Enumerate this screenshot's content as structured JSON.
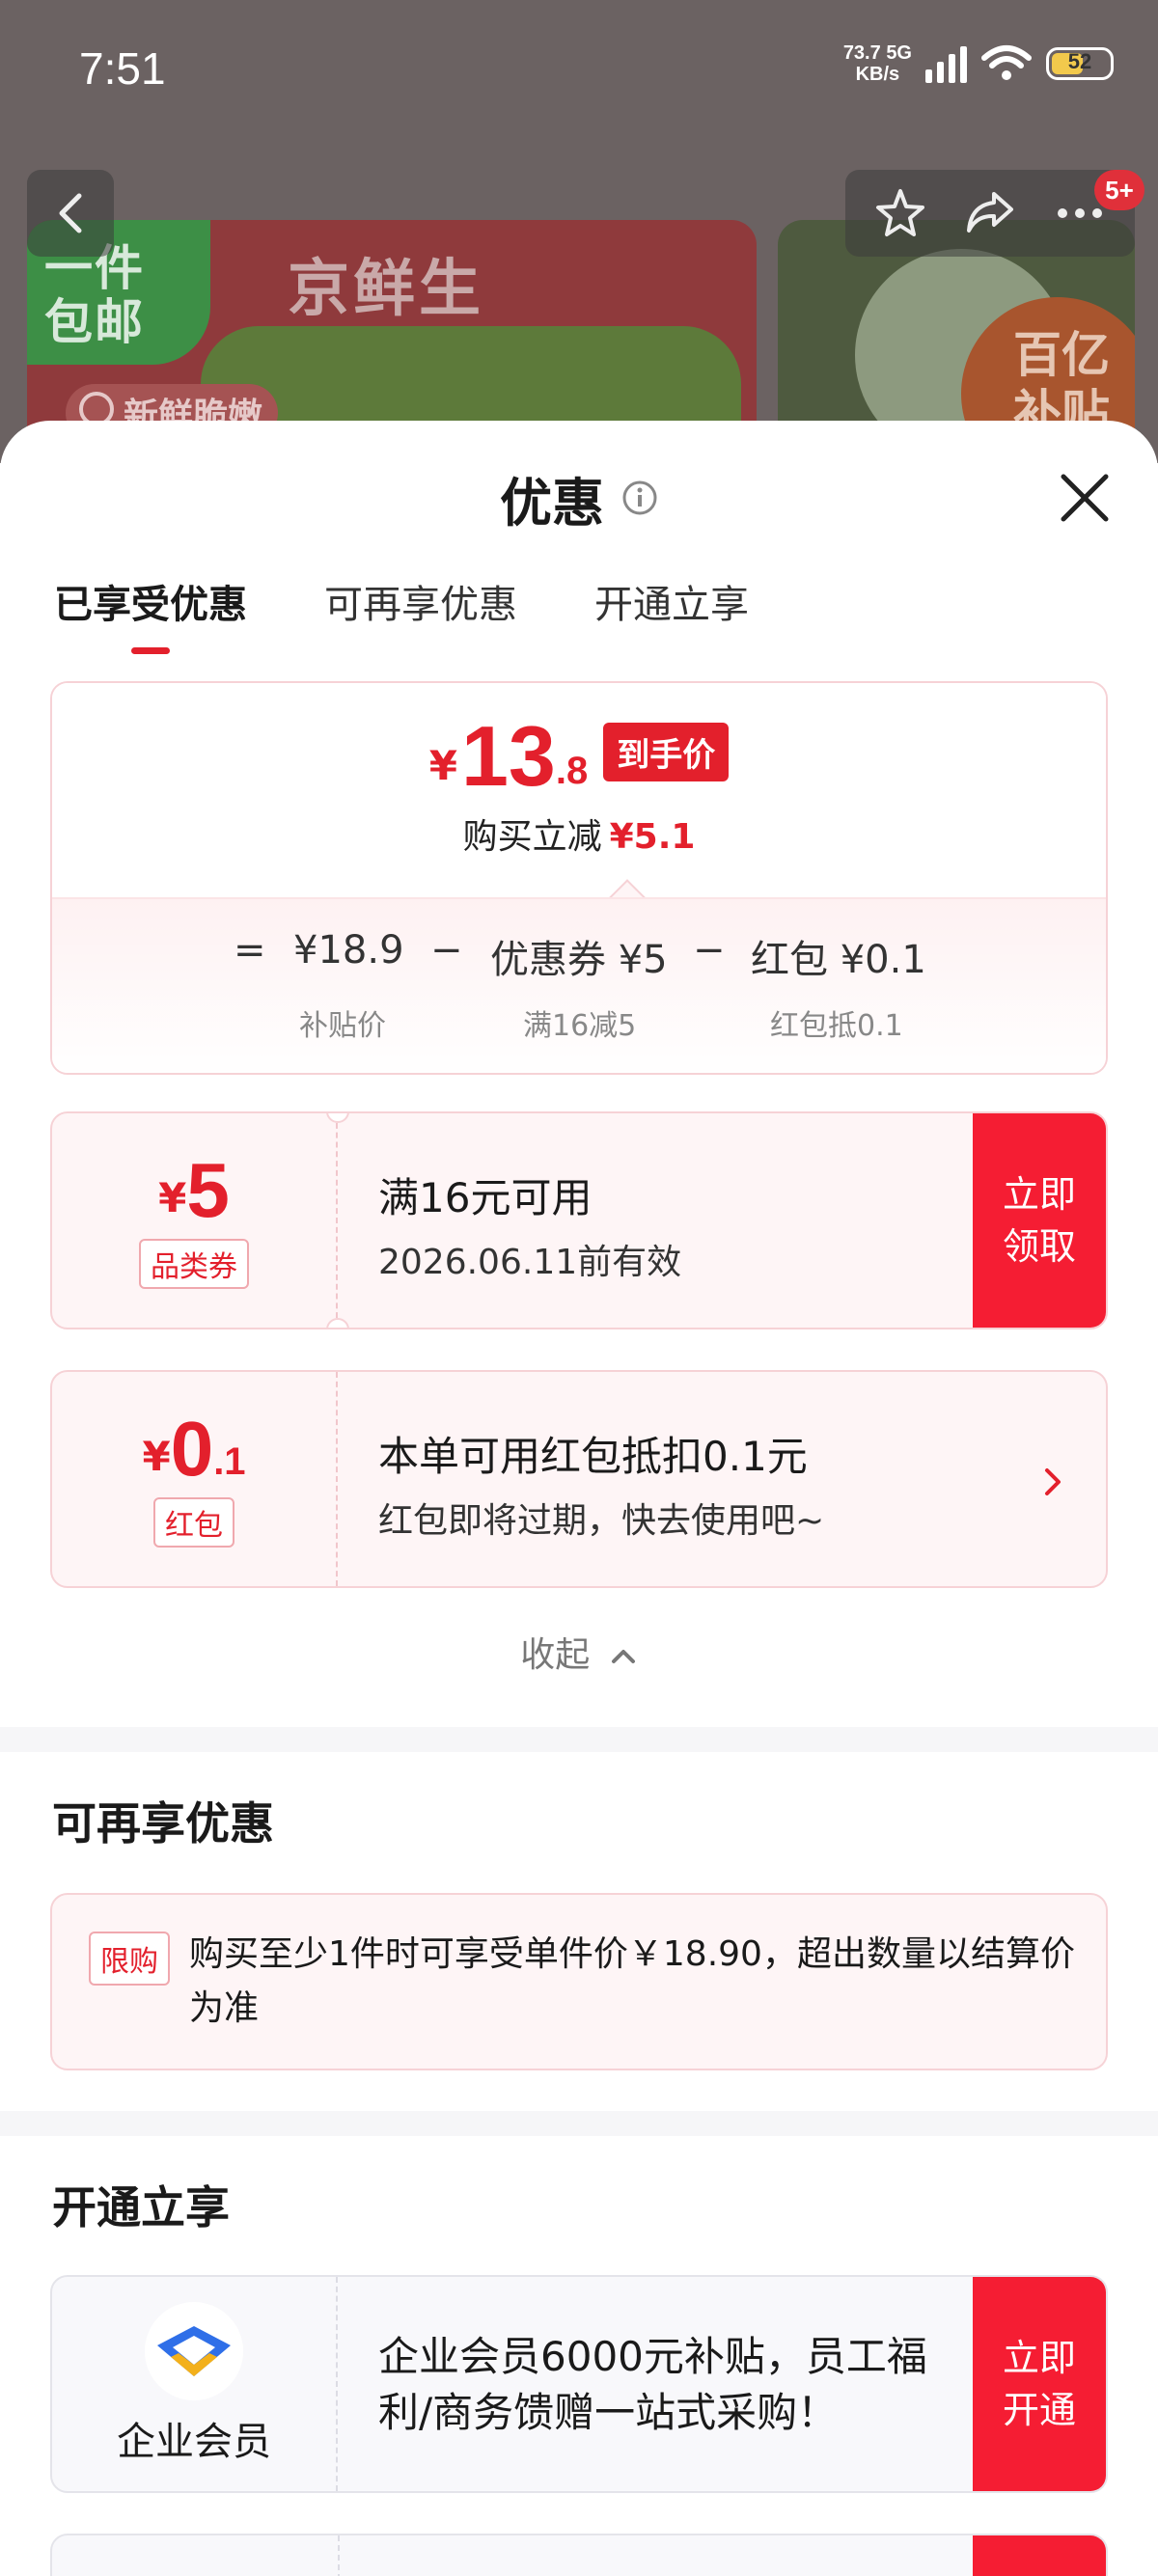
{
  "status_bar": {
    "time": "7:51",
    "net_speed_value": "73.7",
    "net_speed_unit": "KB/s",
    "network": "5G",
    "battery": "52"
  },
  "background": {
    "badge_left_line1": "一件",
    "badge_left_line2": "包邮",
    "brand": "京鲜生",
    "fresh_tag": "新鲜脆嫩",
    "side_badge_line1": "百亿",
    "side_badge_line2": "补贴",
    "nav_badge": "5+"
  },
  "sheet": {
    "title": "优惠",
    "tabs": [
      {
        "label": "已享受优惠"
      },
      {
        "label": "可再享优惠"
      },
      {
        "label": "开通立享"
      }
    ]
  },
  "price_summary": {
    "currency": "¥",
    "price_int": "13",
    "price_dec": ".8",
    "price_tag": "到手价",
    "reduce_label": "购买立减",
    "reduce_amount": "¥5.1",
    "eq": "=",
    "minus": "−",
    "base_price": "¥18.9",
    "base_label": "补贴价",
    "coupon_text": "优惠券 ¥5",
    "coupon_sub": "满16减5",
    "redpacket_text": "红包 ¥0.1",
    "redpacket_sub": "红包抵0.1"
  },
  "coupons": [
    {
      "yen": "¥",
      "amount": "5",
      "decimal": "",
      "type": "品类券",
      "line1": "满16元可用",
      "line2": "2026.06.11前有效",
      "button": "立即\n领取"
    },
    {
      "yen": "¥",
      "amount": "0",
      "decimal": ".1",
      "type": "红包",
      "line1": "本单可用红包抵扣0.1元",
      "line2": "红包即将过期，快去使用吧~"
    }
  ],
  "collapse_label": "收起",
  "more_offers": {
    "title": "可再享优惠",
    "tag": "限购",
    "text": "购买至少1件时可享受单件价￥18.90，超出数量以结算价为准"
  },
  "open_now": {
    "title": "开通立享",
    "member_name": "企业会员",
    "member_desc": "企业会员6000元补贴，员工福利/商务馈赠一站式采购！",
    "button": "立即\n开通"
  },
  "colors": {
    "accent": "#e3202c",
    "button_red": "#f51d33",
    "card_border": "#f6d2d6",
    "card_bg": "#fef5f6"
  }
}
